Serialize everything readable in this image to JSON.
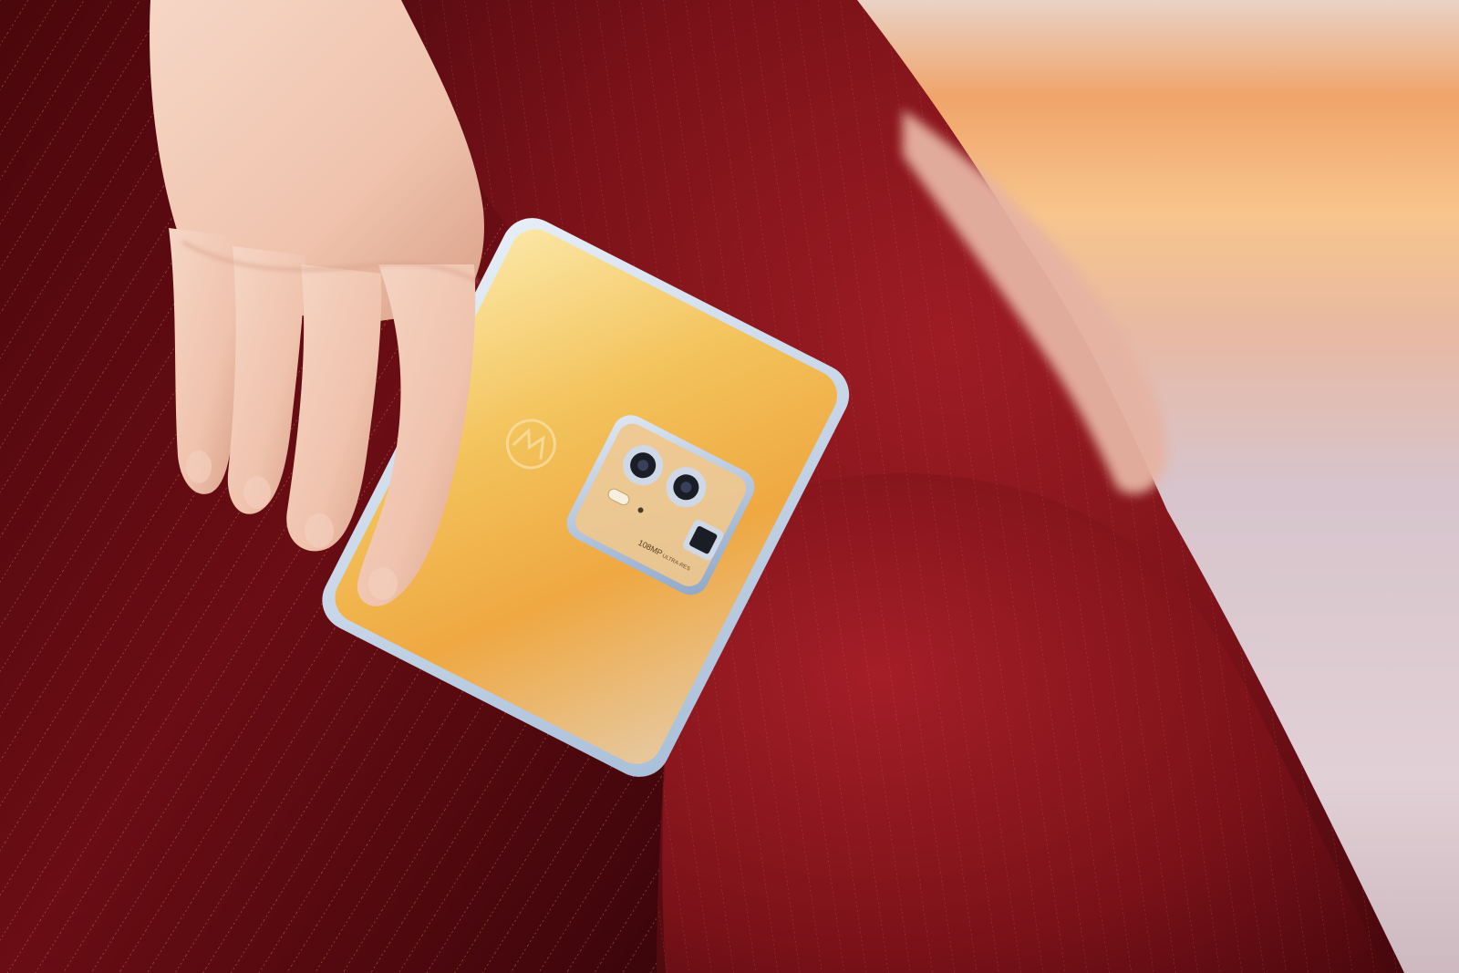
{
  "phone": {
    "camera_label": "108MP",
    "camera_sublabel": "ULTRA-RES"
  },
  "colors": {
    "fabric_dark": "#3a070b",
    "fabric_mid": "#6e1118",
    "fabric_light": "#9b1c22",
    "phone_gold": "#f2b24a",
    "phone_silver": "#cfd9ea",
    "skin": "#f0c7b2",
    "sky_warm": "#f6b27a",
    "sky_cool": "#d9c7cc"
  }
}
